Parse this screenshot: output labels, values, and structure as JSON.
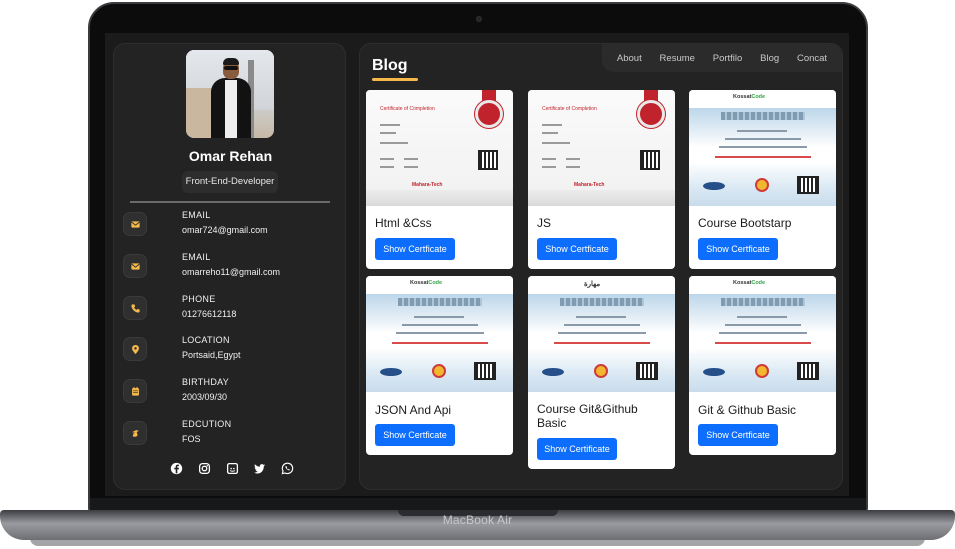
{
  "device": {
    "brand": "MacBook Air"
  },
  "profile": {
    "name": "Omar Rehan",
    "role": "Front-End-Developer",
    "info": [
      {
        "icon": "envelope-icon",
        "title": "EMAIL",
        "value": "omar724@gmail.com"
      },
      {
        "icon": "envelope-icon",
        "title": "EMAIL",
        "value": "omarreho11@gmail.com"
      },
      {
        "icon": "phone-icon",
        "title": "PHONE",
        "value": "01276612118"
      },
      {
        "icon": "location-pin-icon",
        "title": "LOCATION",
        "value": "Portsaid,Egypt"
      },
      {
        "icon": "calendar-icon",
        "title": "BIRTHDAY",
        "value": "2003/09/30"
      },
      {
        "icon": "graduation-icon",
        "title": "EDCUTION",
        "value": "FOS"
      }
    ],
    "socials": [
      "facebook-icon",
      "instagram-icon",
      "discord-icon",
      "twitter-icon",
      "whatsapp-icon"
    ]
  },
  "nav": {
    "items": [
      "About",
      "Resume",
      "Portfilo",
      "Blog",
      "Concat"
    ]
  },
  "blog": {
    "title": "Blog",
    "cards": [
      {
        "title": "Html &Css",
        "button": "Show Certficate",
        "thumb_title": "Certificate of Completion",
        "thumb_logo": "Mahara-Tech"
      },
      {
        "title": "JS",
        "button": "Show Certficate",
        "thumb_title": "Certificate of Completion",
        "thumb_logo": "Mahara-Tech"
      },
      {
        "title": "Course Bootstarp",
        "button": "Show Certficate",
        "thumb_header": "Kossat",
        "thumb_header_accent": "Code"
      },
      {
        "title": "JSON And Api",
        "button": "Show Certficate",
        "thumb_header": "Kossat",
        "thumb_header_accent": "Code"
      },
      {
        "title": "Course Git&Github Basic",
        "button": "Show Certificate",
        "thumb_header": "مهارة",
        "thumb_header_accent": ""
      },
      {
        "title": "Git & Github Basic",
        "button": "Show Certficate",
        "thumb_header": "Kossat",
        "thumb_header_accent": "Code"
      }
    ]
  },
  "colors": {
    "accent": "#f5b94b",
    "button": "#0d6efd",
    "panel": "#232323",
    "background": "#1b1b1b"
  }
}
